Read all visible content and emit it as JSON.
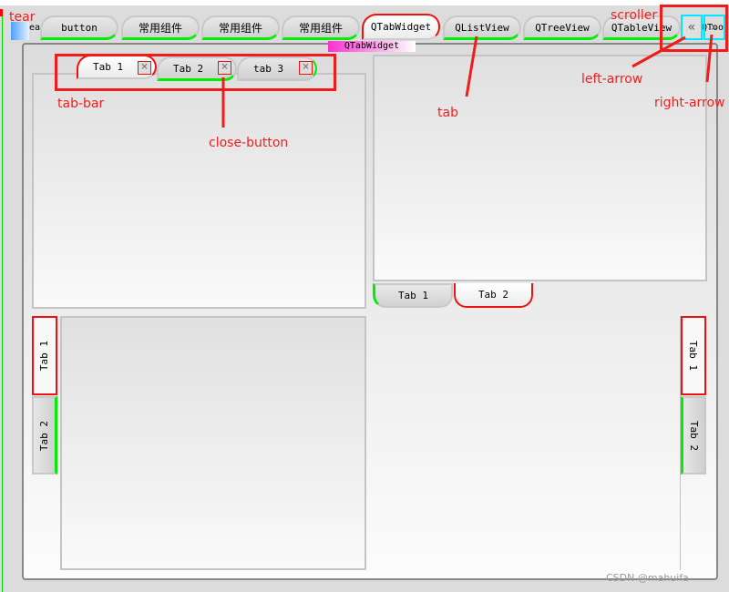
{
  "main_tabs": [
    {
      "label": "ea"
    },
    {
      "label": "button"
    },
    {
      "label": "常用组件"
    },
    {
      "label": "常用组件"
    },
    {
      "label": "常用组件"
    },
    {
      "label": "QTabWidget"
    },
    {
      "label": "QListView"
    },
    {
      "label": "QTreeView"
    },
    {
      "label": "QTableView"
    },
    {
      "label": "QTool"
    }
  ],
  "tooltip": "QTabWidget",
  "scroller": {
    "left": "«",
    "right": "»"
  },
  "north_tabs": [
    {
      "label": "Tab 1"
    },
    {
      "label": "Tab 2"
    },
    {
      "label": "tab 3"
    }
  ],
  "close_glyph": "×",
  "south_tabs": [
    {
      "label": "Tab 1"
    },
    {
      "label": "Tab 2"
    }
  ],
  "west_tabs": [
    {
      "label": "Tab 1"
    },
    {
      "label": "Tab 2"
    }
  ],
  "east_tabs": [
    {
      "label": "Tab 1"
    },
    {
      "label": "Tab 2"
    }
  ],
  "annotations": {
    "tear": "tear",
    "tab_bar": "tab-bar",
    "close_button": "close-button",
    "tab": "tab",
    "scroller": "scroller",
    "left_arrow": "left-arrow",
    "right_arrow": "right-arrow"
  },
  "watermark": "CSDN @mahuifa",
  "colors": {
    "selected_border": "#f01010",
    "unselected_accent": "#00ee00",
    "scroller_border": "#00e8ff",
    "tooltip": "#ff40d0"
  }
}
